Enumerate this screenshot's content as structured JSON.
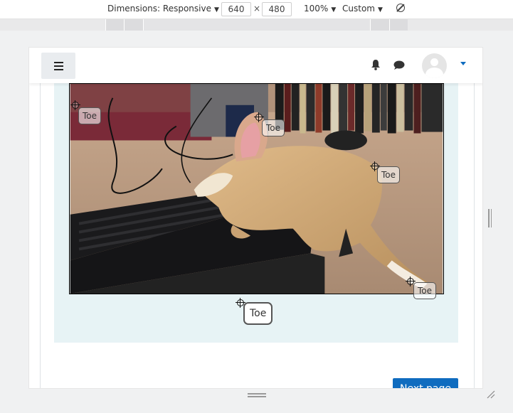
{
  "devtools": {
    "dimensions_label": "Dimensions: Responsive",
    "width": "640",
    "times": "×",
    "height": "480",
    "zoom": "100%",
    "throttle": "Custom",
    "icons": [
      "caret-down-icon",
      "rotate-icon"
    ]
  },
  "navbar": {
    "icons": [
      "menu-icon",
      "bell-icon",
      "chat-icon",
      "avatar",
      "caret-down-icon"
    ],
    "accent_color": "#0f6cbf"
  },
  "question": {
    "background_color": "#e7f3f5",
    "image_alt": "Stuffed toy on a desk next to a keyboard",
    "drop_markers": [
      {
        "label": "Toe"
      },
      {
        "label": "Toe"
      },
      {
        "label": "Toe"
      },
      {
        "label": "Toe"
      }
    ],
    "drag_item": {
      "label": "Toe"
    }
  },
  "footer": {
    "next_button": "Next page"
  }
}
